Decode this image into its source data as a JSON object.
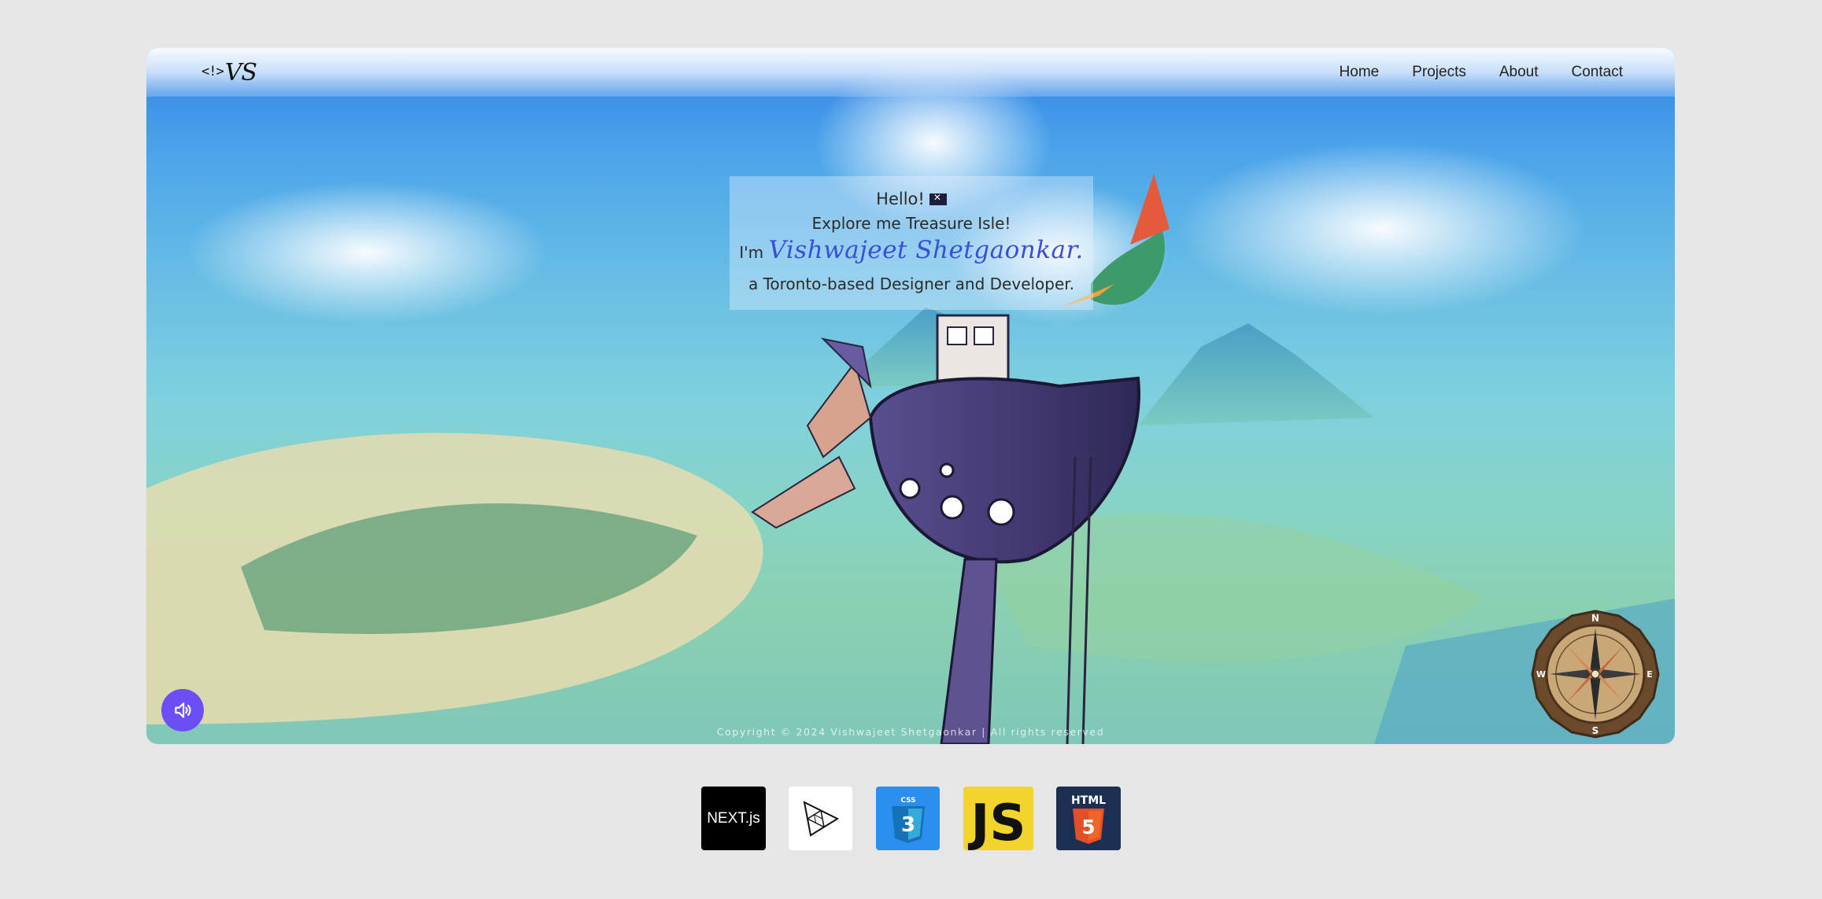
{
  "navbar": {
    "logo_bracket": "<!>",
    "logo_text": "VS",
    "links": [
      "Home",
      "Projects",
      "About",
      "Contact"
    ]
  },
  "intro": {
    "greeting": "Hello!",
    "subtitle": "Explore me Treasure Isle!",
    "im_prefix": "I'm",
    "name": "Vishwajeet Shetgaonkar.",
    "tagline": "a Toronto-based Designer and Developer."
  },
  "footer": {
    "copyright": "Copyright © 2024 Vishwajeet Shetgaonkar | All rights reserved"
  },
  "compass": {
    "n": "N",
    "s": "S",
    "e": "E",
    "w": "W"
  },
  "tech_stack": {
    "next_label": "NEXT.js",
    "css_label": "CSS",
    "js_label": "JS",
    "html_label": "HTML"
  },
  "icons": {
    "sound": "speaker-icon",
    "three": "threejs-icon"
  },
  "colors": {
    "accent": "#6c4ef5",
    "name": "#3a4fd8",
    "sky_top": "#2f7fe6",
    "sea": "#86d4c6"
  }
}
